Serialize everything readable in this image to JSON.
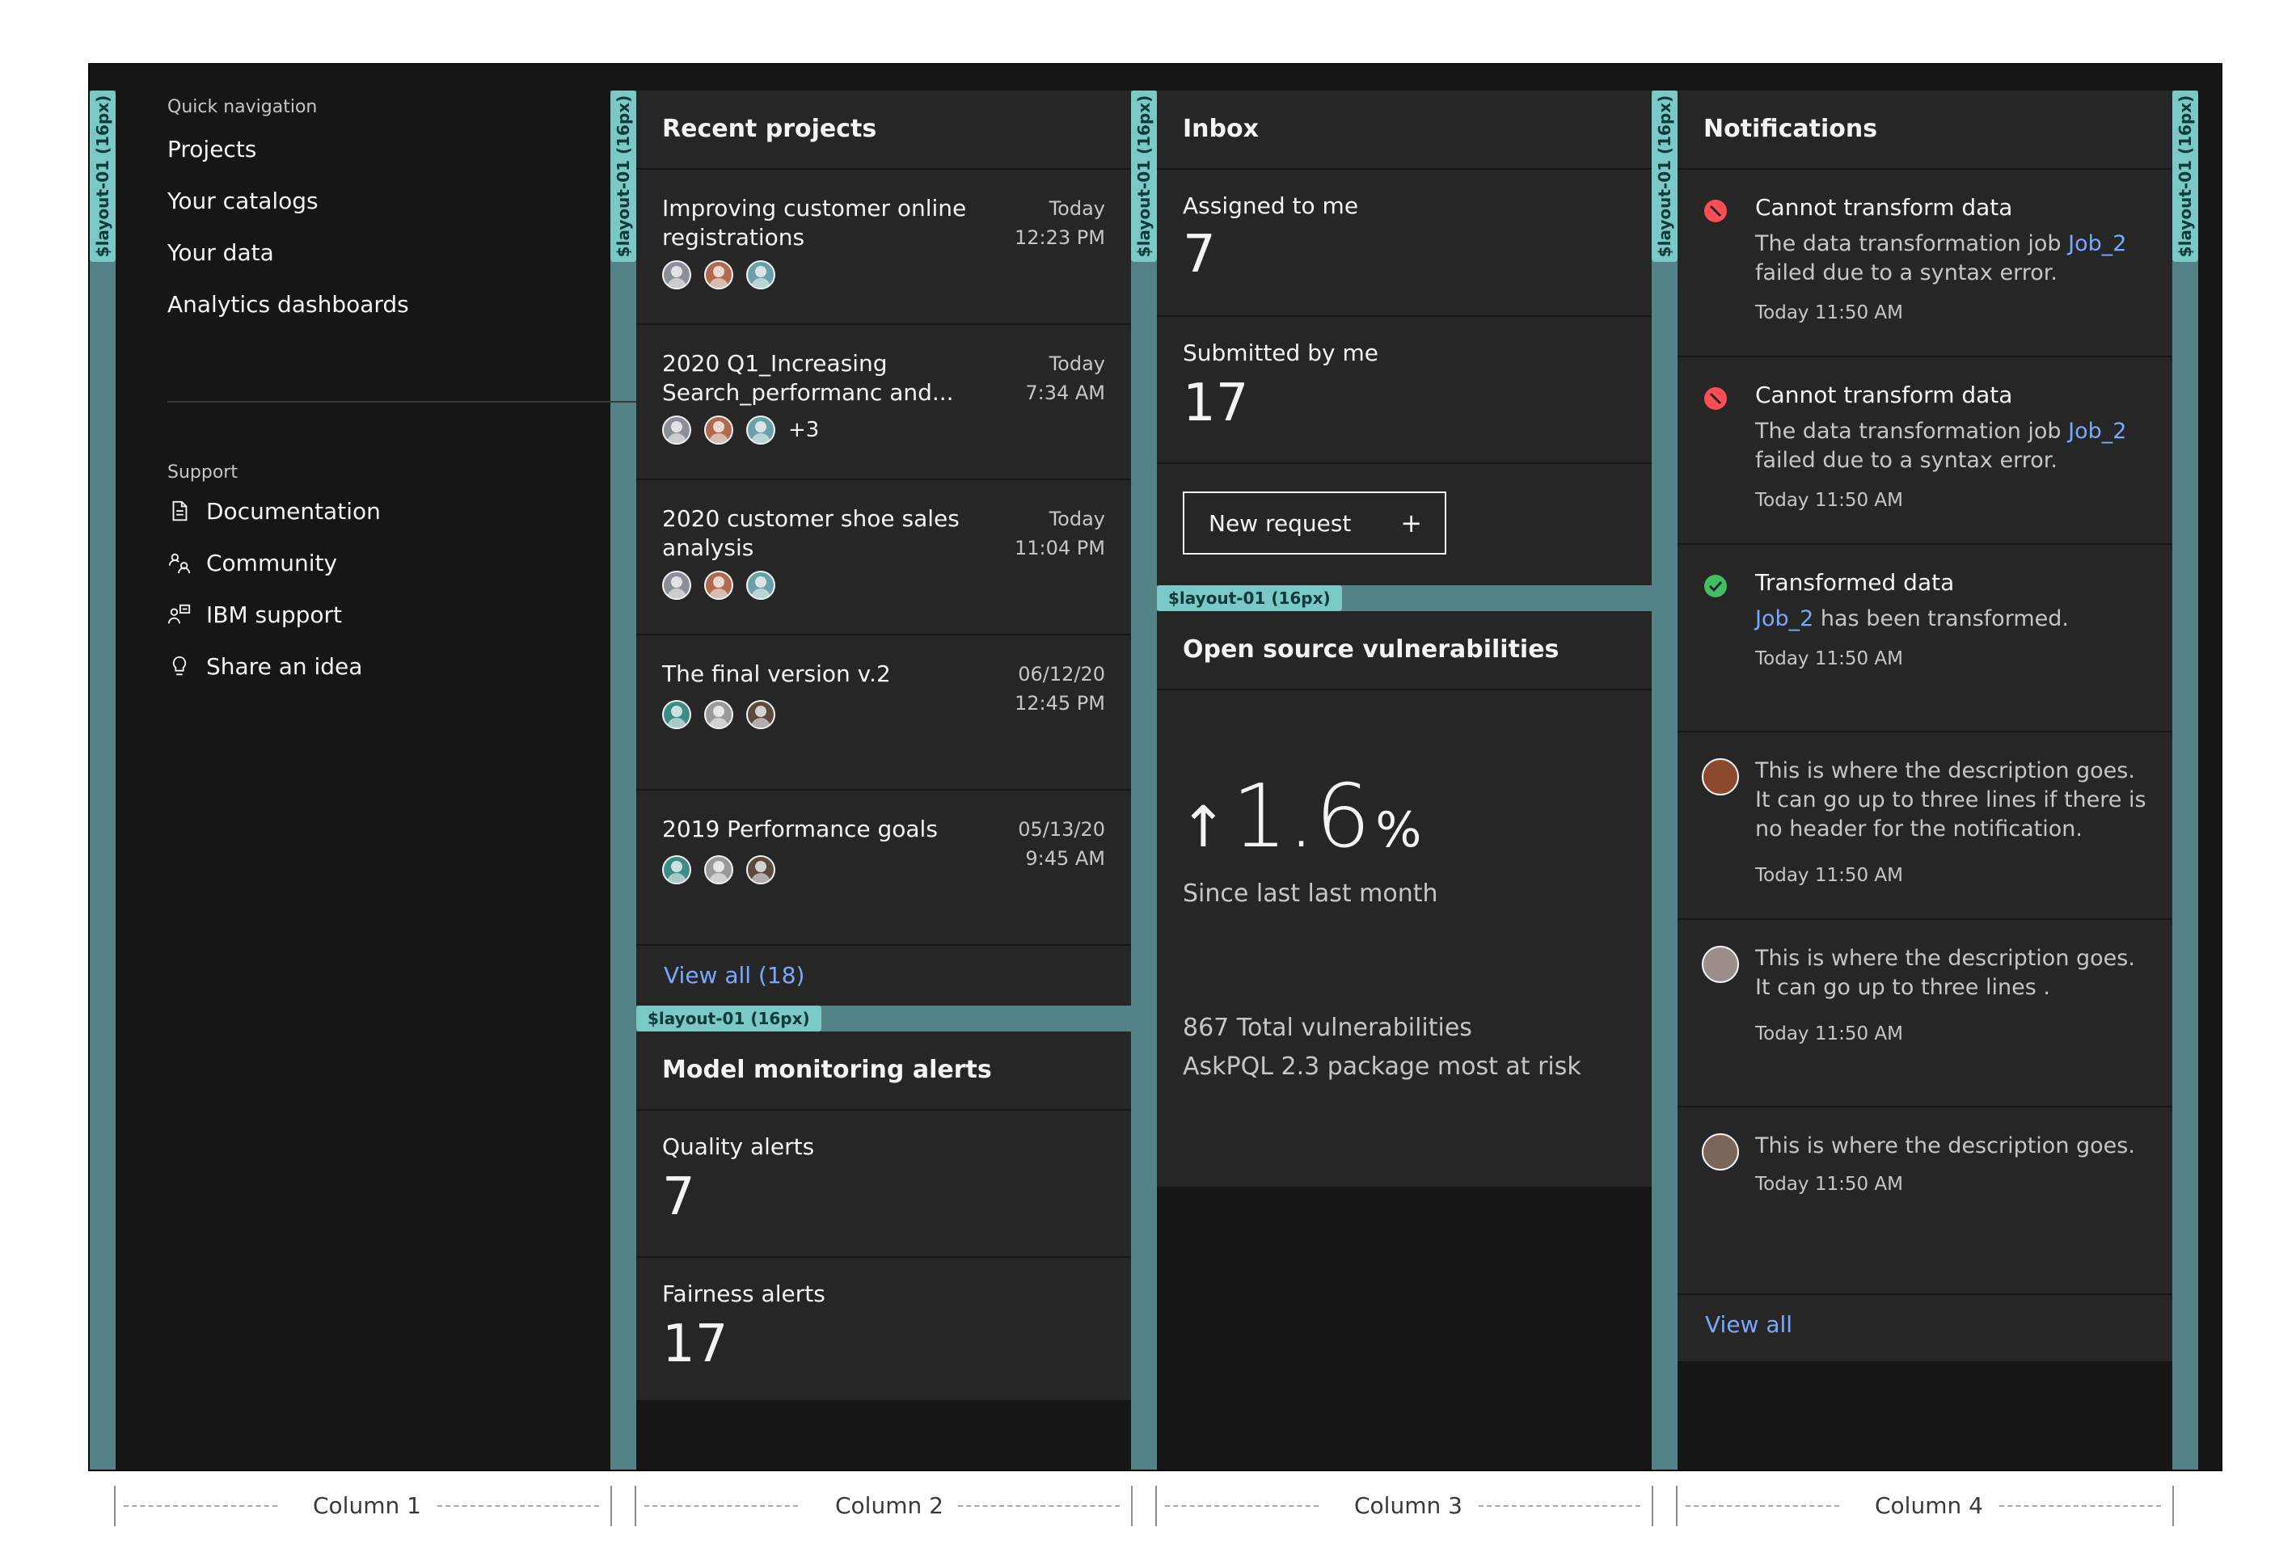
{
  "colors": {
    "background": "#161616",
    "card": "#262626",
    "gutter": "#538386",
    "gutter_label": "#7ac9c6",
    "link": "#78a9ff",
    "error": "#fa4d56",
    "success": "#42be65"
  },
  "spacing_label": "$layout-01 (16px)",
  "nav": {
    "quick_label": "Quick navigation",
    "links": [
      "Projects",
      "Your catalogs",
      "Your data",
      "Analytics dashboards"
    ],
    "support_label": "Support",
    "support": [
      {
        "label": "Documentation",
        "icon": "document-icon"
      },
      {
        "label": "Community",
        "icon": "community-icon"
      },
      {
        "label": "IBM support",
        "icon": "support-icon"
      },
      {
        "label": "Share an idea",
        "icon": "lightbulb-icon"
      }
    ]
  },
  "recent_projects": {
    "title": "Recent projects",
    "items": [
      {
        "title": "Improving customer online registrations",
        "date": "Today",
        "time": "12:23 PM",
        "extra": ""
      },
      {
        "title": "2020 Q1_Increasing Search_performanc and...",
        "date": "Today",
        "time": "7:34 AM",
        "extra": "+3"
      },
      {
        "title": "2020 customer shoe sales analysis",
        "date": "Today",
        "time": "11:04 PM",
        "extra": ""
      },
      {
        "title": "The final version v.2",
        "date": "06/12/20",
        "time": "12:45 PM",
        "extra": ""
      },
      {
        "title": "2019 Performance goals",
        "date": "05/13/20",
        "time": "9:45 AM",
        "extra": ""
      }
    ],
    "view_all": "View all (18)"
  },
  "model_alerts": {
    "title": "Model monitoring alerts",
    "quality_label": "Quality alerts",
    "quality_value": "7",
    "fairness_label": "Fairness alerts",
    "fairness_value": "17"
  },
  "inbox": {
    "title": "Inbox",
    "assigned_label": "Assigned to me",
    "assigned_value": "7",
    "submitted_label": "Submitted by me",
    "submitted_value": "17",
    "new_request": "New request",
    "plus": "+"
  },
  "vulnerabilities": {
    "title": "Open source vulnerabilities",
    "arrow": "↑",
    "value": "1.6",
    "unit": "%",
    "since": "Since last last month",
    "total": "867 Total vulnerabilities",
    "risk": "AskPQL 2.3 package most at risk"
  },
  "notifications": {
    "title": "Notifications",
    "items": [
      {
        "type": "error",
        "title": "Cannot transform data",
        "body_pre": "The data transformation job ",
        "link": "Job_2",
        "body_post": " failed due to a syntax error.",
        "time": "Today 11:50 AM"
      },
      {
        "type": "error",
        "title": "Cannot transform data",
        "body_pre": "The data transformation job ",
        "link": "Job_2",
        "body_post": " failed due to a syntax error.",
        "time": "Today 11:50 AM"
      },
      {
        "type": "success",
        "title": "Transformed data",
        "body_pre": "",
        "link": "Job_2",
        "body_post": " has been transformed.",
        "time": "Today 11:50 AM"
      },
      {
        "type": "avatar",
        "title": "",
        "body_pre": "This is where the description goes. It can go up to three lines if there is no header for the notification.",
        "link": "",
        "body_post": "",
        "time": "Today 11:50 AM"
      },
      {
        "type": "avatar",
        "title": "",
        "body_pre": "This is where the description goes. It can go up to three lines .",
        "link": "",
        "body_post": "",
        "time": "Today 11:50 AM"
      },
      {
        "type": "avatar",
        "title": "",
        "body_pre": "This is where the description goes.",
        "link": "",
        "body_post": "",
        "time": "Today 11:50 AM"
      }
    ],
    "view_all": "View all"
  },
  "columns": [
    "Column 1",
    "Column 2",
    "Column 3",
    "Column 4"
  ]
}
